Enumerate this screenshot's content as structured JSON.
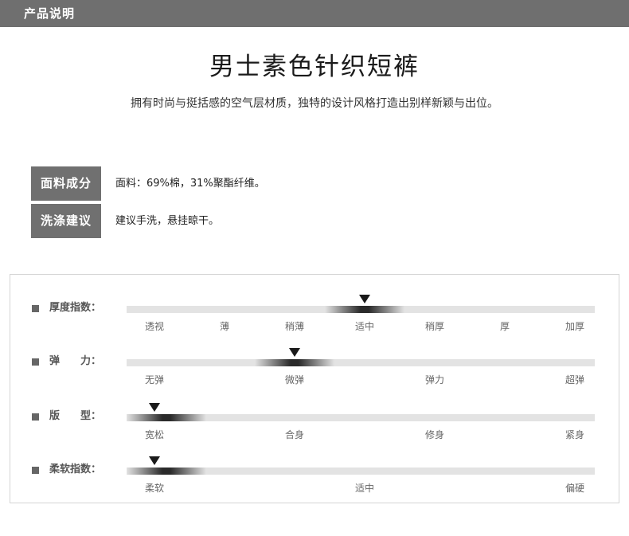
{
  "header": {
    "title": "产品说明"
  },
  "product": {
    "title": "男士素色针织短裤",
    "subtitle": "拥有时尚与挺括感的空气层材质，独特的设计风格打造出别样新颖与出位。"
  },
  "specs": [
    {
      "label": "面料成分",
      "value": "面料：69%棉，31%聚酯纤维。"
    },
    {
      "label": "洗涤建议",
      "value": "建议手洗，悬挂晾干。"
    }
  ],
  "colors": {
    "header_bg": "#6f6f6f",
    "label_bg": "#707070",
    "track": "#e3e3e3",
    "marker": "#1a1a1a"
  },
  "scales": [
    {
      "label": "厚度指数：",
      "ticks": [
        "透视",
        "薄",
        "稍薄",
        "适中",
        "稍厚",
        "厚",
        "加厚"
      ],
      "selected": "适中",
      "selected_index": 3
    },
    {
      "label": "弹　　力：",
      "ticks": [
        "无弹",
        "微弹",
        "弹力",
        "超弹"
      ],
      "selected": "微弹",
      "selected_index": 1
    },
    {
      "label": "版　　型：",
      "ticks": [
        "宽松",
        "合身",
        "修身",
        "紧身"
      ],
      "selected": "宽松",
      "selected_index": 0
    },
    {
      "label": "柔软指数：",
      "ticks": [
        "柔软",
        "适中",
        "偏硬"
      ],
      "selected": "柔软",
      "selected_index": 0
    }
  ]
}
